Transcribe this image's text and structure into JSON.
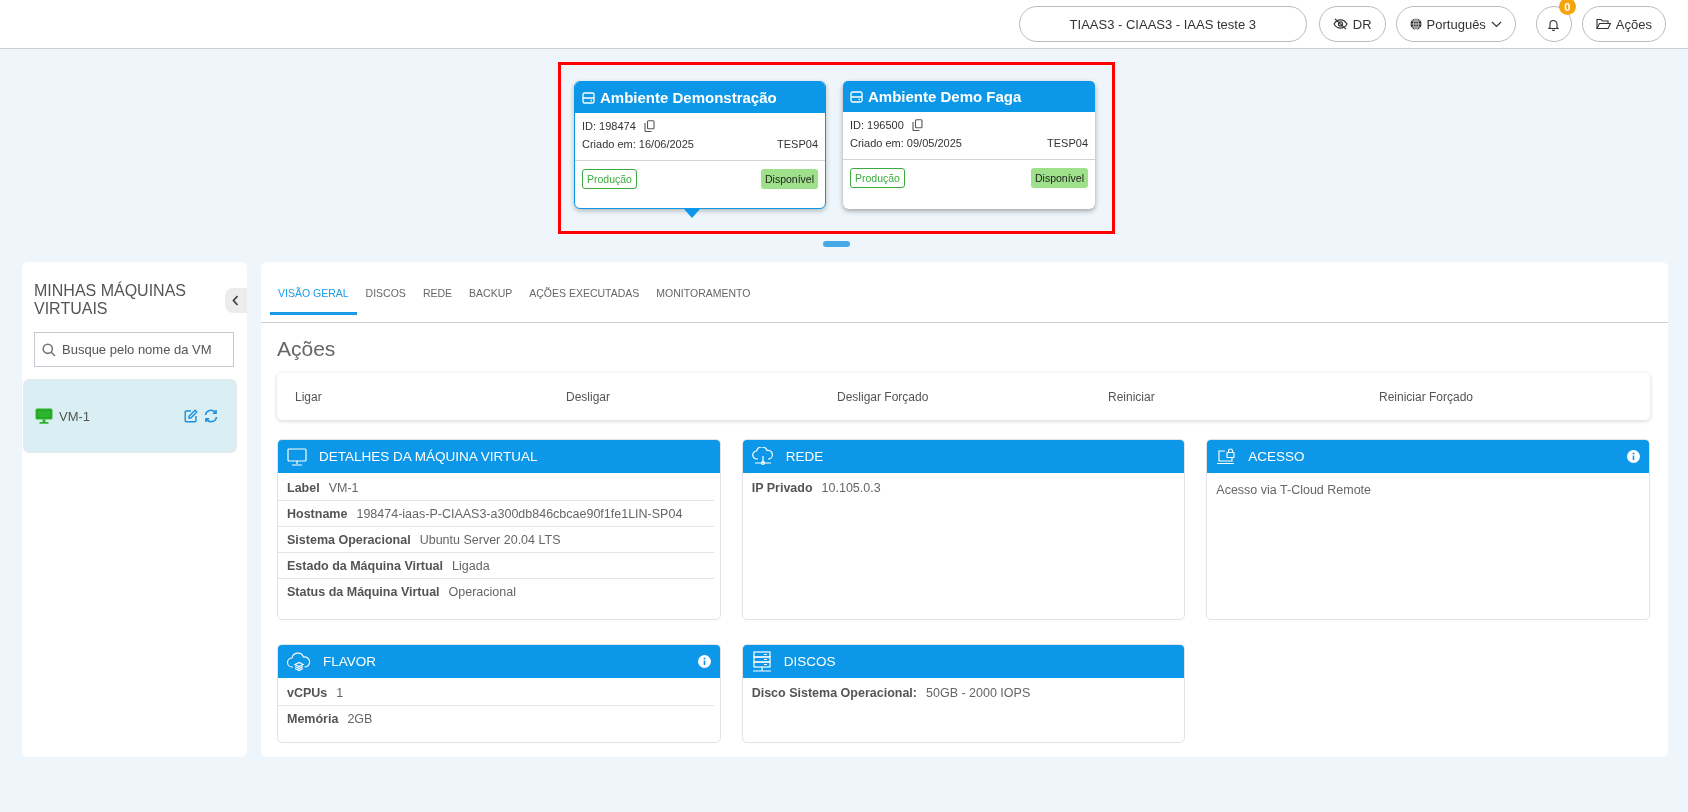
{
  "header": {
    "project": "TIAAS3 - CIAAS3 - IAAS teste 3",
    "dr": "DR",
    "language": "Português",
    "notifications": "0",
    "actions": "Ações"
  },
  "environments": [
    {
      "name": "Ambiente Demonstração",
      "id": "ID: 198474",
      "created": "Criado em: 16/06/2025",
      "region": "TESP04",
      "type": "Produção",
      "status": "Disponível",
      "selected": true
    },
    {
      "name": "Ambiente Demo Faga",
      "id": "ID: 196500",
      "created": "Criado em: 09/05/2025",
      "region": "TESP04",
      "type": "Produção",
      "status": "Disponível",
      "selected": false
    }
  ],
  "sidebar": {
    "title": "MINHAS MÁQUINAS VIRTUAIS",
    "search": {
      "placeholder": "Busque pelo nome da VM"
    },
    "vms": [
      {
        "name": "VM-1",
        "selected": true
      }
    ]
  },
  "tabs": [
    {
      "label": "VISÃO GERAL",
      "selected": true
    },
    {
      "label": "DISCOS",
      "selected": false
    },
    {
      "label": "REDE",
      "selected": false
    },
    {
      "label": "BACKUP",
      "selected": false
    },
    {
      "label": "AÇÕES EXECUTADAS",
      "selected": false
    },
    {
      "label": "MONITORAMENTO",
      "selected": false
    }
  ],
  "actions_title": "Ações",
  "actions": [
    "Ligar",
    "Desligar",
    "Desligar Forçado",
    "Reiniciar",
    "Reiniciar Forçado"
  ],
  "panels": [
    {
      "title": "DETALHES DA MÁQUINA VIRTUAL",
      "info": false,
      "rows": [
        {
          "label": "Label",
          "value": "VM-1"
        },
        {
          "label": "Hostname",
          "value": "198474-iaas-P-CIAAS3-a300db846cbcae90f1fe1LIN-SP04"
        },
        {
          "label": "Sistema Operacional",
          "value": "Ubuntu Server 20.04 LTS"
        },
        {
          "label": "Estado da Máquina Virtual",
          "value": "Ligada"
        },
        {
          "label": "Status da Máquina Virtual",
          "value": "Operacional"
        }
      ]
    },
    {
      "title": "REDE",
      "info": false,
      "rows": [
        {
          "label": "IP Privado",
          "value": "10.105.0.3"
        }
      ]
    },
    {
      "title": "ACESSO",
      "info": true,
      "text": "Acesso via T-Cloud Remote"
    },
    {
      "title": "FLAVOR",
      "info": true,
      "rows": [
        {
          "label": "vCPUs",
          "value": "1"
        },
        {
          "label": "Memória",
          "value": "2GB"
        }
      ]
    },
    {
      "title": "DISCOS",
      "info": false,
      "rows": [
        {
          "label": "Disco Sistema Operacional:",
          "value": "50GB - 2000 IOPS"
        }
      ]
    }
  ]
}
